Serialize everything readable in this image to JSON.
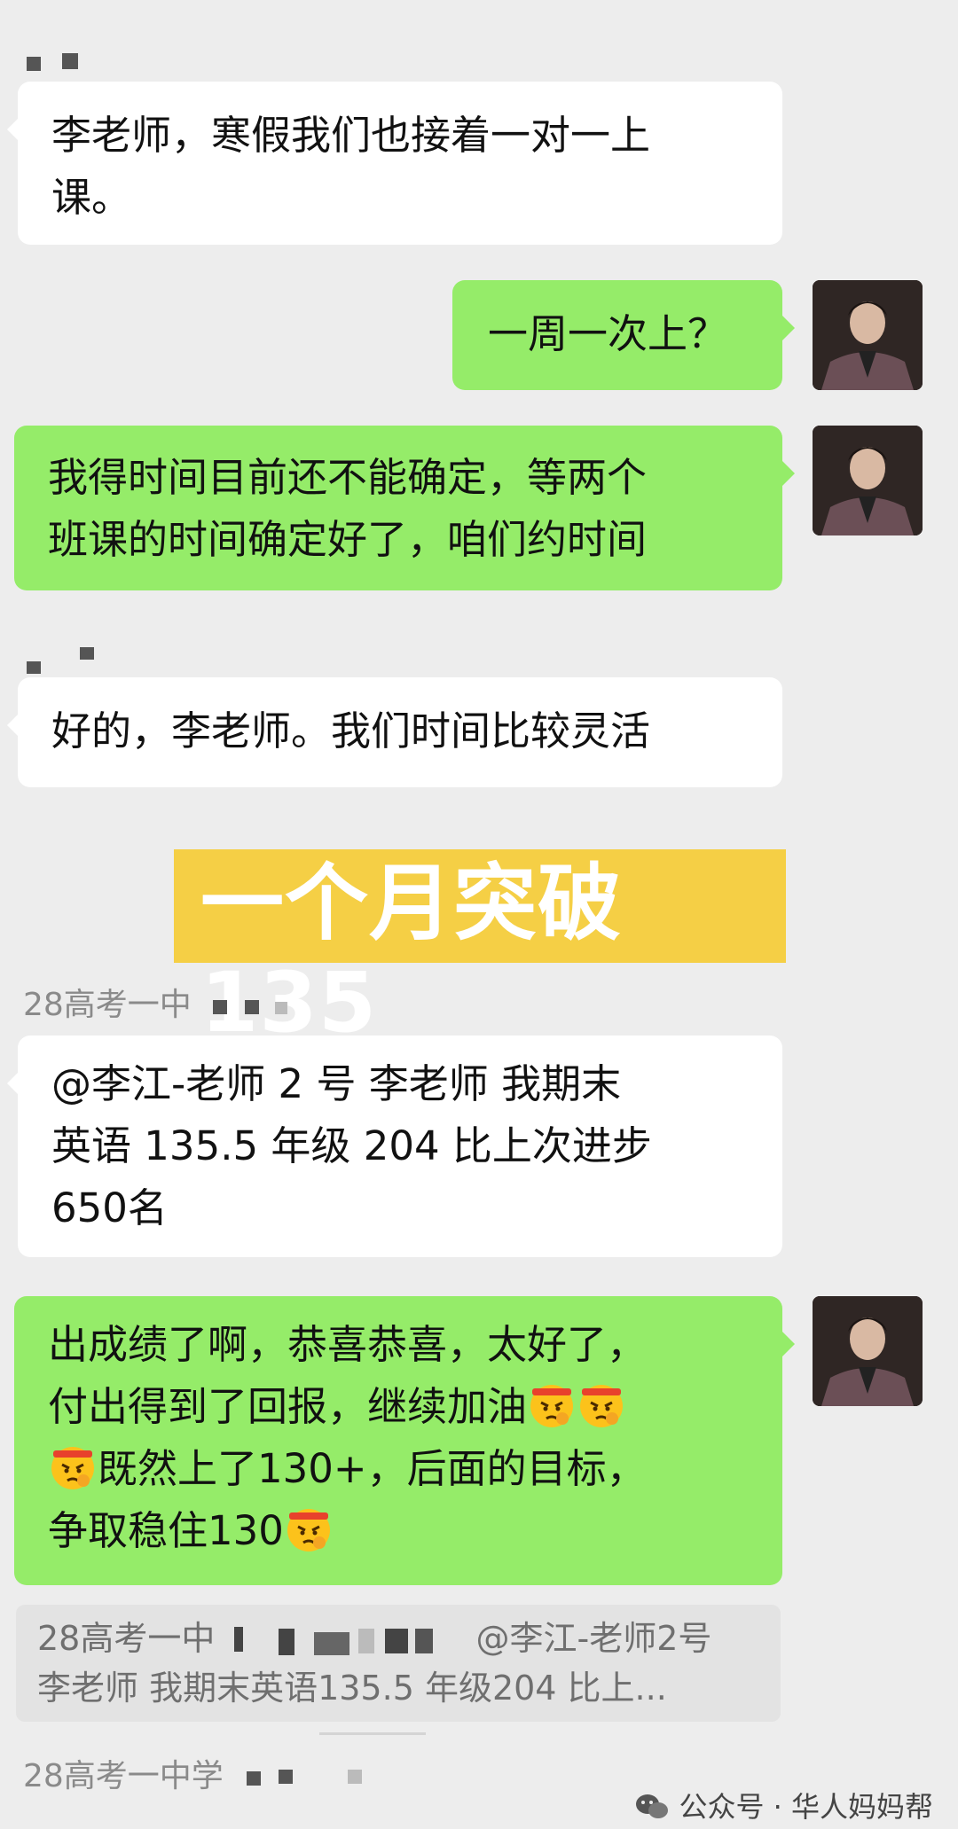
{
  "messages": [
    {
      "lines": [
        "李老师，寒假我们也接着一对一上",
        "课。"
      ]
    },
    {
      "lines": [
        "一周一次上？"
      ]
    },
    {
      "lines": [
        "我得时间目前还不能确定，等两个",
        "班课的时间确定好了，咱们约时间"
      ]
    },
    {
      "lines": [
        "好的，李老师。我们时间比较灵活"
      ]
    },
    {
      "lines": [
        "@李江-老师 2 号  李老师 我期末",
        "英语 135.5 年级 204 比上次进步",
        "650名"
      ]
    },
    {
      "lines": [
        "出成绩了啊，恭喜恭喜，太好了，",
        "付出得到了回报，继续加油",
        "既然上了130+，后面的目标，",
        "争取稳住130"
      ]
    }
  ],
  "banner": {
    "text": "一个月突破135"
  },
  "senders": {
    "group1": "28高考一中",
    "group2": "28高考一中学"
  },
  "quote": {
    "line1_prefix": "28高考一中",
    "line1_mention": "@李江-老师2号",
    "line2": "李老师 我期末英语135.5 年级204 比上..."
  },
  "watermark": {
    "text": "公众号 · 华人妈妈帮"
  },
  "icons": {
    "emoji": "angry-face-headband-emoji",
    "watermark_icon": "wechat-icon"
  },
  "colors": {
    "background": "#ededed",
    "green_bubble": "#95ec69",
    "white_bubble": "#ffffff",
    "banner": "#f5cf45"
  }
}
